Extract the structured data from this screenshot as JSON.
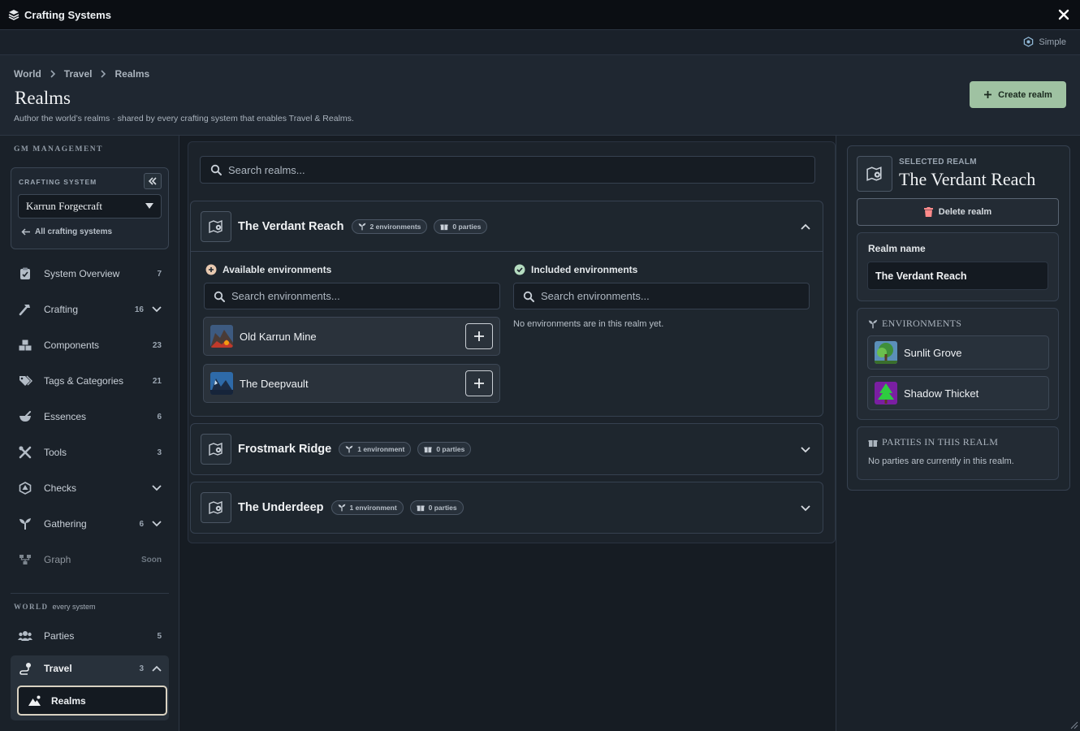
{
  "window": {
    "title": "Crafting Systems",
    "mode_label": "Simple"
  },
  "breadcrumb": [
    "World",
    "Travel",
    "Realms"
  ],
  "page": {
    "title": "Realms",
    "description": "Author the world’s realms · shared by every crafting system that enables Travel & Realms.",
    "create_label": "Create realm"
  },
  "sidebar": {
    "gm_header": "GM MANAGEMENT",
    "crafting_label": "CRAFTING SYSTEM",
    "crafting_value": "Karrun Forgecraft",
    "all_systems": "All crafting systems",
    "items": [
      {
        "label": "System Overview",
        "count": "7",
        "icon": "clipboard-icon"
      },
      {
        "label": "Crafting",
        "count": "16",
        "icon": "hammer-icon",
        "chevron": "down"
      },
      {
        "label": "Components",
        "count": "23",
        "icon": "cubes-icon"
      },
      {
        "label": "Tags & Categories",
        "count": "21",
        "icon": "tags-icon"
      },
      {
        "label": "Essences",
        "count": "6",
        "icon": "mortar-icon"
      },
      {
        "label": "Tools",
        "count": "3",
        "icon": "tools-icon"
      },
      {
        "label": "Checks",
        "count": "",
        "icon": "dice-icon",
        "chevron": "down"
      },
      {
        "label": "Gathering",
        "count": "6",
        "icon": "seedling-icon",
        "chevron": "down"
      },
      {
        "label": "Graph",
        "count": "Soon",
        "icon": "graph-icon"
      }
    ],
    "world_header": "WORLD",
    "world_sub": "every system",
    "world_items": [
      {
        "label": "Parties",
        "count": "5",
        "icon": "users-icon"
      },
      {
        "label": "Travel",
        "count": "3",
        "icon": "route-icon",
        "chevron": "up"
      }
    ],
    "sub_item": "Realms"
  },
  "search": {
    "placeholder": "Search realms..."
  },
  "realms": [
    {
      "name": "The Verdant Reach",
      "environments": "2 environments",
      "parties": "0 parties",
      "expanded": true
    },
    {
      "name": "Frostmark Ridge",
      "environments": "1 environment",
      "parties": "0 parties",
      "expanded": false
    },
    {
      "name": "The Underdeep",
      "environments": "1 environment",
      "parties": "0 parties",
      "expanded": false
    }
  ],
  "expanded": {
    "available_label": "Available environments",
    "included_label": "Included environments",
    "search_placeholder": "Search environments...",
    "available": [
      "Old Karrun Mine",
      "The Deepvault"
    ],
    "empty_included": "No environments are in this realm yet."
  },
  "detail": {
    "selected_label": "SELECTED REALM",
    "name": "The Verdant Reach",
    "delete_label": "Delete realm",
    "realm_name_label": "Realm name",
    "realm_name_value": "The Verdant Reach",
    "environments_label": "ENVIRONMENTS",
    "environments": [
      "Sunlit Grove",
      "Shadow Thicket"
    ],
    "parties_label": "PARTIES IN THIS REALM",
    "parties_empty": "No parties are currently in this realm."
  },
  "colors": {
    "accent": "#9fc2a2",
    "background": "#0d1117",
    "panel": "#1e262e"
  }
}
